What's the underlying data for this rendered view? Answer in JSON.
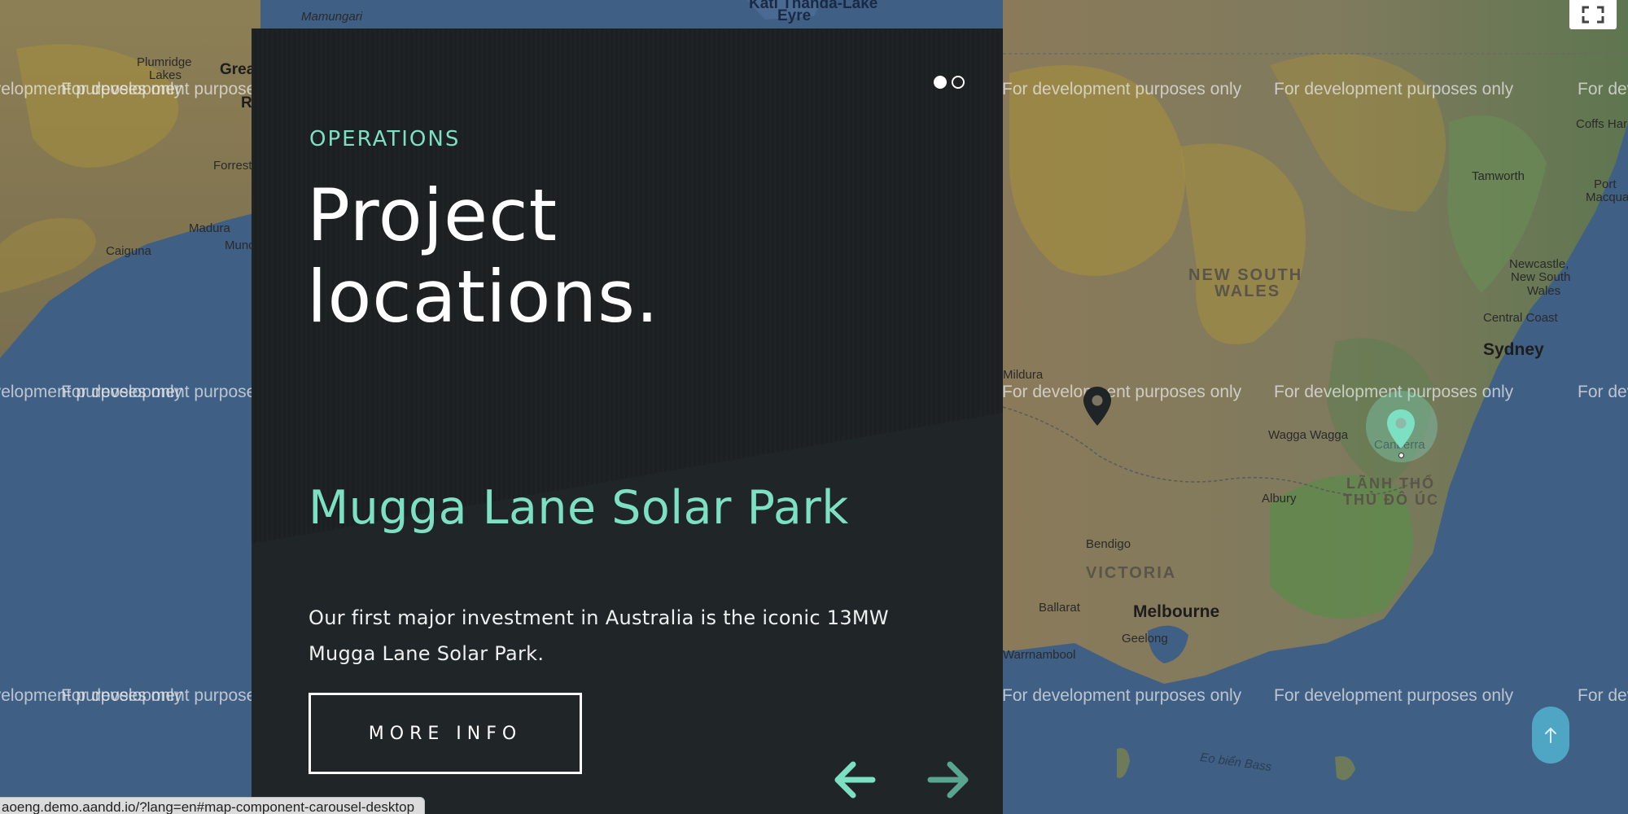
{
  "map": {
    "watermark": "For development purposes only",
    "places": {
      "mamungari": "Mamungari",
      "lake_eyre_a": "Kati Thanda-Lake",
      "lake_eyre_b": "Eyre",
      "plumridge_a": "Plumridge",
      "plumridge_b": "Lakes",
      "great_a": "Grea",
      "great_b": "R",
      "forrest": "Forrest",
      "madura": "Madura",
      "caiguna": "Caiguna",
      "mun": "Munc",
      "coffs": "Coffs Harb",
      "tamworth": "Tamworth",
      "port_macq_a": "Port",
      "port_macq_b": "Macquari",
      "newcastle_a": "Newcastle,",
      "newcastle_b": "New South",
      "newcastle_c": "Wales",
      "central_coast": "Central Coast",
      "sydney": "Sydney",
      "nsw_a": "NEW SOUTH",
      "nsw_b": "WALES",
      "mildura": "Mildura",
      "wagga": "Wagga Wagga",
      "canberra": "Canberra",
      "act_a": "LÃNH THỔ",
      "act_b": "THỦ ĐÔ ÚC",
      "albury": "Albury",
      "bendigo": "Bendigo",
      "victoria": "VICTORIA",
      "ballarat": "Ballarat",
      "melbourne": "Melbourne",
      "geelong": "Geelong",
      "warrnambool": "Warrnambool",
      "bass_strait": "Eo biển Bass"
    }
  },
  "carousel": {
    "eyebrow": "OPERATIONS",
    "title_line1": "Project",
    "title_line2": "locations.",
    "project_name": "Mugga Lane Solar Park",
    "description": "Our first major investment in Australia is the iconic 13MW Mugga Lane Solar Park.",
    "more_button": "MORE INFO",
    "page_count": 2,
    "active_page": 1
  },
  "status_url": "aoeng.demo.aandd.io/?lang=en#map-component-carousel-desktop",
  "colors": {
    "accent": "#7ee0c3",
    "panel": "#1c2021",
    "ocean": "#3f5f84",
    "scroll_button": "#4fa6c4"
  },
  "icons": {
    "fullscreen": "fullscreen-icon",
    "marker_inactive": "map-pin-icon",
    "marker_active": "map-pin-icon",
    "prev": "arrow-left-icon",
    "next": "arrow-right-icon",
    "scroll_top": "arrow-up-icon"
  }
}
